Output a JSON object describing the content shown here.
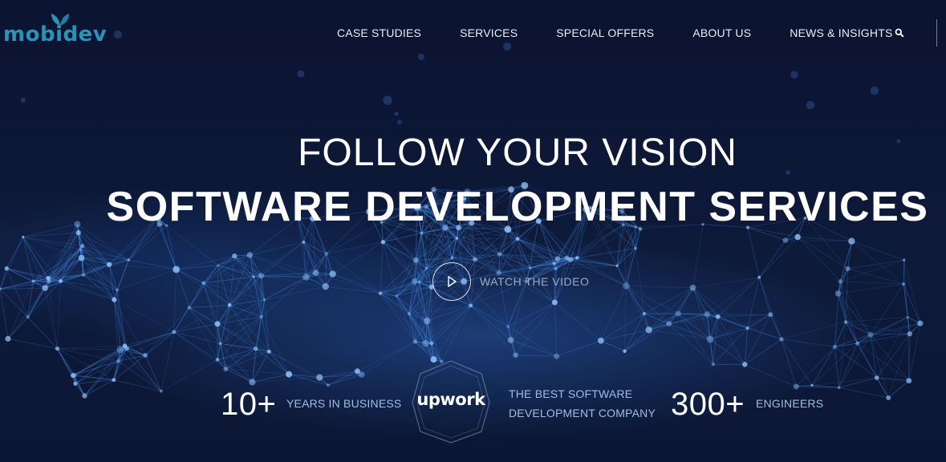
{
  "brand": {
    "logo_text": "mobidev",
    "accent_color": "#2a93b6"
  },
  "nav": {
    "items": [
      {
        "label": "CASE STUDIES"
      },
      {
        "label": "SERVICES"
      },
      {
        "label": "SPECIAL OFFERS"
      },
      {
        "label": "ABOUT US"
      },
      {
        "label": "NEWS & INSIGHTS"
      }
    ],
    "search_icon": "search-icon"
  },
  "hero": {
    "headline": "FOLLOW YOUR VISION",
    "subheadline": "SOFTWARE DEVELOPMENT SERVICES",
    "video_label": "WATCH THE VIDEO",
    "play_icon": "play-icon"
  },
  "stats": {
    "years": {
      "value": "10+",
      "label": "YEARS IN BUSINESS"
    },
    "badge": {
      "text": "upwork",
      "line1": "THE BEST SOFTWARE",
      "line2": "DEVELOPMENT COMPANY"
    },
    "engineers": {
      "value": "300+",
      "label": "ENGINEERS"
    }
  }
}
